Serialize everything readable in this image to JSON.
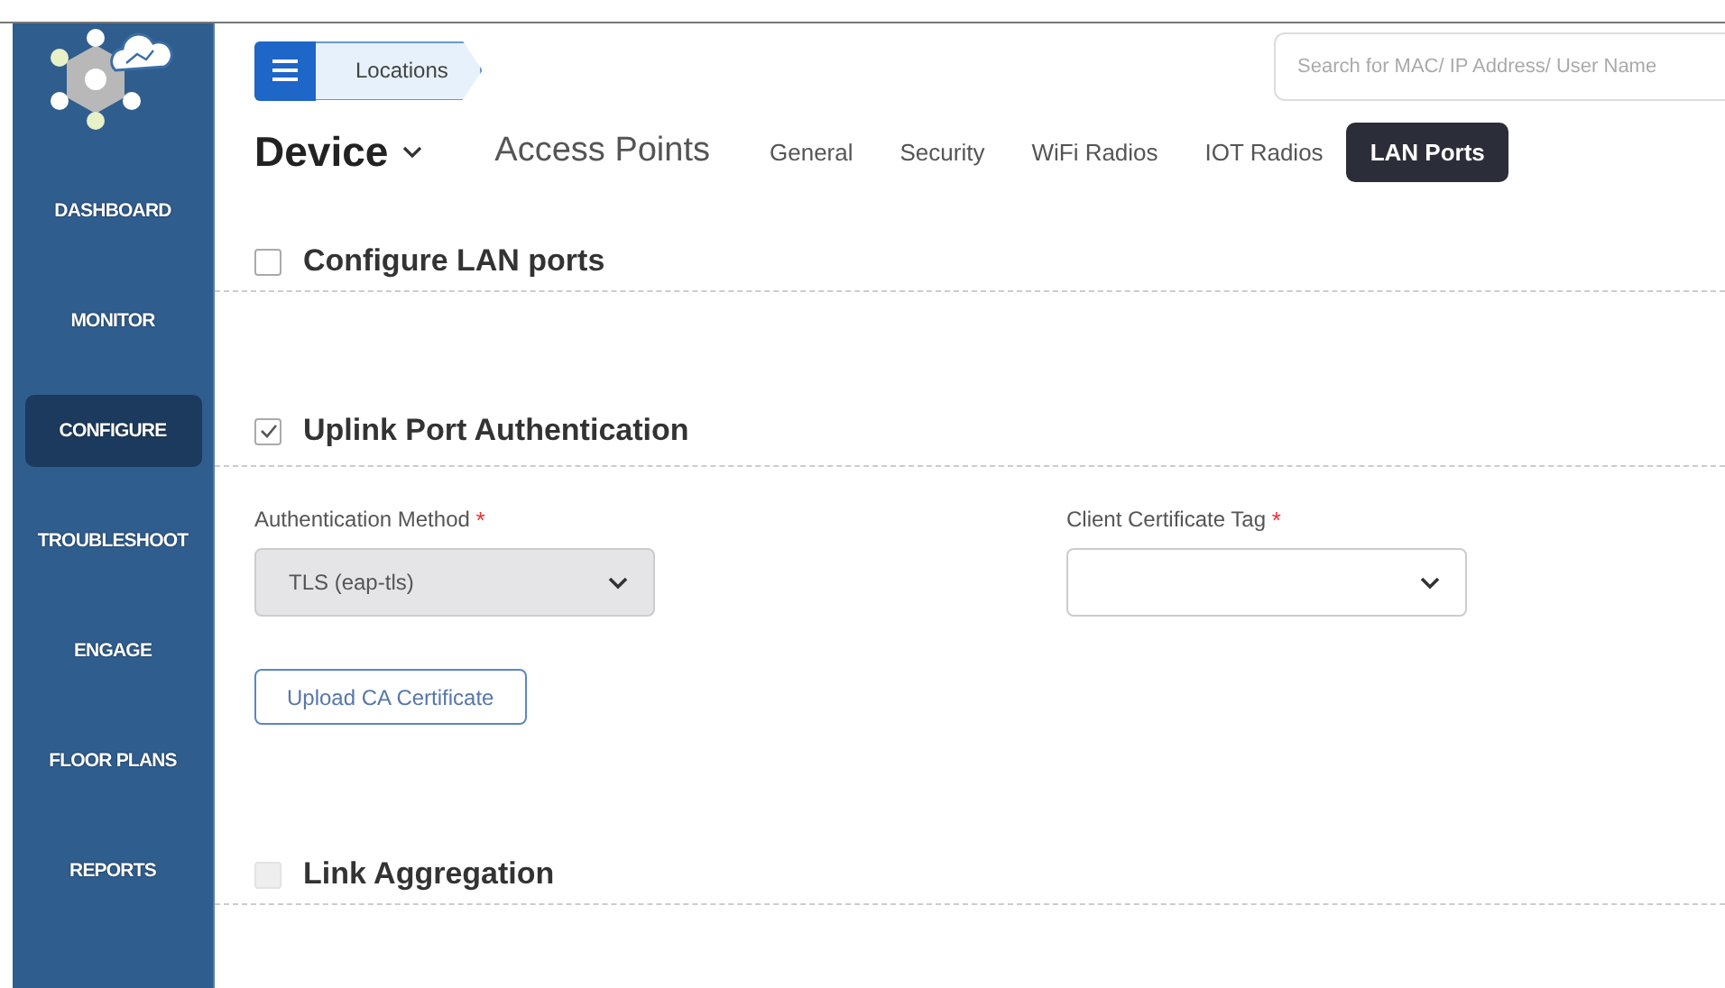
{
  "sidebar": {
    "items": [
      {
        "label": "DASHBOARD",
        "selected": false
      },
      {
        "label": "MONITOR",
        "selected": false
      },
      {
        "label": "CONFIGURE",
        "selected": true
      },
      {
        "label": "TROUBLESHOOT",
        "selected": false
      },
      {
        "label": "ENGAGE",
        "selected": false
      },
      {
        "label": "FLOOR PLANS",
        "selected": false
      },
      {
        "label": "REPORTS",
        "selected": false
      }
    ]
  },
  "breadcrumb": {
    "label": "Locations"
  },
  "search": {
    "placeholder": "Search for MAC/ IP Address/ User Name"
  },
  "page_title": "Device",
  "subtitle": "Access Points",
  "tabs": [
    {
      "label": "General",
      "selected": false
    },
    {
      "label": "Security",
      "selected": false
    },
    {
      "label": "WiFi Radios",
      "selected": false
    },
    {
      "label": "IOT Radios",
      "selected": false
    },
    {
      "label": "LAN Ports",
      "selected": true
    }
  ],
  "sections": [
    {
      "title": "Configure LAN ports",
      "checked": false,
      "disabled": false
    },
    {
      "title": "Uplink Port Authentication",
      "checked": true,
      "disabled": false,
      "fields": [
        {
          "label": "Authentication Method",
          "required_mark": "*",
          "value": "TLS (eap-tls)",
          "disabled": true
        },
        {
          "label": "Client Certificate Tag",
          "required_mark": "*",
          "disabled": false
        }
      ],
      "button": "Upload CA Certificate"
    },
    {
      "title": "Link Aggregation",
      "checked": false,
      "disabled": true
    }
  ]
}
